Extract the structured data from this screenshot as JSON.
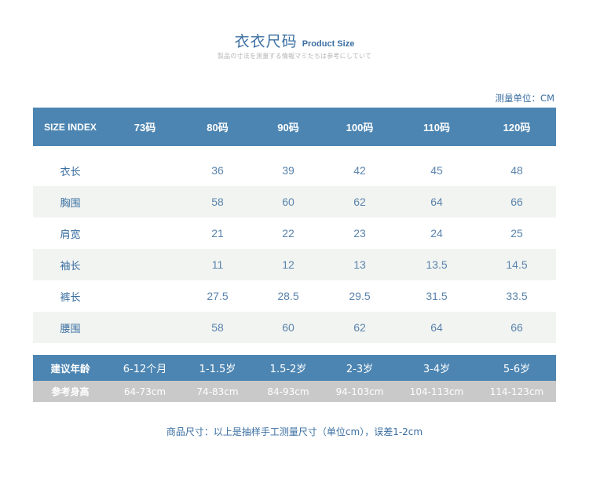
{
  "header": {
    "title_cn": "衣衣尺码",
    "title_en": "Product Size",
    "subtitle": "製品の寸法を測量する情報マミたちは参考にしていて"
  },
  "unit_note": "测量单位：CM",
  "size_table": {
    "columns": [
      "SIZE INDEX",
      "73码",
      "80码",
      "90码",
      "100码",
      "110码",
      "120码"
    ],
    "rows": [
      {
        "label": "衣长",
        "values": [
          "",
          "36",
          "39",
          "42",
          "45",
          "48"
        ]
      },
      {
        "label": "胸围",
        "values": [
          "",
          "58",
          "60",
          "62",
          "64",
          "66"
        ]
      },
      {
        "label": "肩宽",
        "values": [
          "",
          "21",
          "22",
          "23",
          "24",
          "25"
        ]
      },
      {
        "label": "袖长",
        "values": [
          "",
          "11",
          "12",
          "13",
          "13.5",
          "14.5"
        ]
      },
      {
        "label": "裤长",
        "values": [
          "",
          "27.5",
          "28.5",
          "29.5",
          "31.5",
          "33.5"
        ]
      },
      {
        "label": "腰围",
        "values": [
          "",
          "58",
          "60",
          "62",
          "64",
          "66"
        ]
      }
    ]
  },
  "age_table": {
    "age_row": {
      "label": "建议年龄",
      "values": [
        "6-12个月",
        "1-1.5岁",
        "1.5-2岁",
        "2-3岁",
        "3-4岁",
        "5-6岁"
      ]
    },
    "height_row": {
      "label": "参考身高",
      "values": [
        "64-73cm",
        "74-83cm",
        "84-93cm",
        "94-103cm",
        "104-113cm",
        "114-123cm"
      ]
    }
  },
  "footnote": "商品尺寸：以上是抽样手工测量尺寸（单位cm），误差1-2cm",
  "colors": {
    "header_bar": "#4c85b2",
    "alt_row": "#f1f4f1",
    "height_bar": "#c9c9c9",
    "text_blue": "#3b6fa2"
  }
}
